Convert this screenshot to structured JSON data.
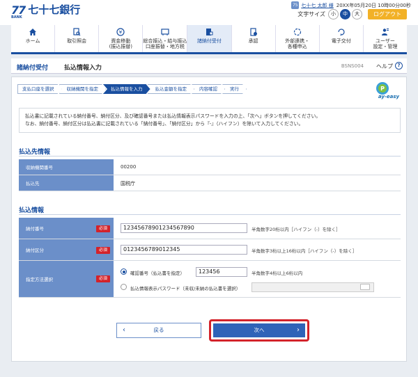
{
  "header": {
    "logo_mark": "77",
    "logo_bank": "BANK",
    "bank_name": "七十七銀行",
    "user_badge": "75",
    "user_name": "七十七 太郎 様",
    "datetime": "20XX年05月20日 10時00分00秒",
    "font_size_label": "文字サイズ",
    "font_sizes": [
      "小",
      "中",
      "大"
    ],
    "font_size_selected": "中",
    "logout_label": "ログアウト"
  },
  "nav": [
    {
      "label": "ホーム",
      "icon": "home-icon"
    },
    {
      "label": "取引照会",
      "icon": "search-doc-icon"
    },
    {
      "label": "資金移動\n(振込振替)",
      "icon": "yen-transfer-icon"
    },
    {
      "label": "総合振込・給与振込\n口座振替・地方税",
      "icon": "card-icon"
    },
    {
      "label": "諸納付受付",
      "icon": "pay-doc-icon",
      "active": true
    },
    {
      "label": "承認",
      "icon": "approve-icon"
    },
    {
      "label": "外部連携・\n各種申込",
      "icon": "link-icon"
    },
    {
      "label": "電子交付",
      "icon": "refresh-icon"
    },
    {
      "label": "ユーザー\n設定・管理",
      "icon": "user-settings-icon"
    }
  ],
  "titlebar": {
    "section": "諸納付受付",
    "page": "払込情報入力",
    "code": "BSNS004",
    "help": "ヘルプ"
  },
  "steps": [
    "支払口座を選択",
    "収納機関を指定",
    "払込情報を入力",
    "払込金額を指定",
    "内容確認",
    "実行"
  ],
  "active_step": 2,
  "notice": {
    "line1": "払込書に記載されている納付番号、納付区分、及び確認番号または払込情報表示パスワードを入力の上、「次へ」ボタンを押してください。",
    "line2": "なお、納付番号、納付区分は払込書に記載されている「納付番号」、「納付区分」から『-』（ハイフン）を除いて入力してください。"
  },
  "payee": {
    "heading": "払込先情報",
    "rows": [
      {
        "label": "収納機関番号",
        "value": "00200"
      },
      {
        "label": "払込先",
        "value": "国税庁"
      }
    ]
  },
  "payment": {
    "heading": "払込情報",
    "required_label": "必須",
    "number": {
      "label": "納付番号",
      "value": "12345678901234567890",
      "hint": "半角数字20桁以内［ハイフン（-）を除く］"
    },
    "category": {
      "label": "納付区分",
      "value": "0123456789012345",
      "hint": "半角数字3桁以上16桁以内［ハイフン（-）を除く］"
    },
    "method": {
      "label": "指定方法選択",
      "option1": {
        "label": "確認番号（払込書を指定）",
        "value": "123456",
        "hint": "半角数字4桁以上6桁以内",
        "selected": true
      },
      "option2": {
        "label": "払込情報表示パスワード（未収/未納の払込書を選択）",
        "value": "",
        "selected": false
      }
    }
  },
  "buttons": {
    "back": "戻る",
    "next": "次へ"
  },
  "colors": {
    "brand": "#1a4fa0",
    "label_bg": "#6b8fc9",
    "required": "#d3222a",
    "accent_logout": "#f2b127"
  }
}
